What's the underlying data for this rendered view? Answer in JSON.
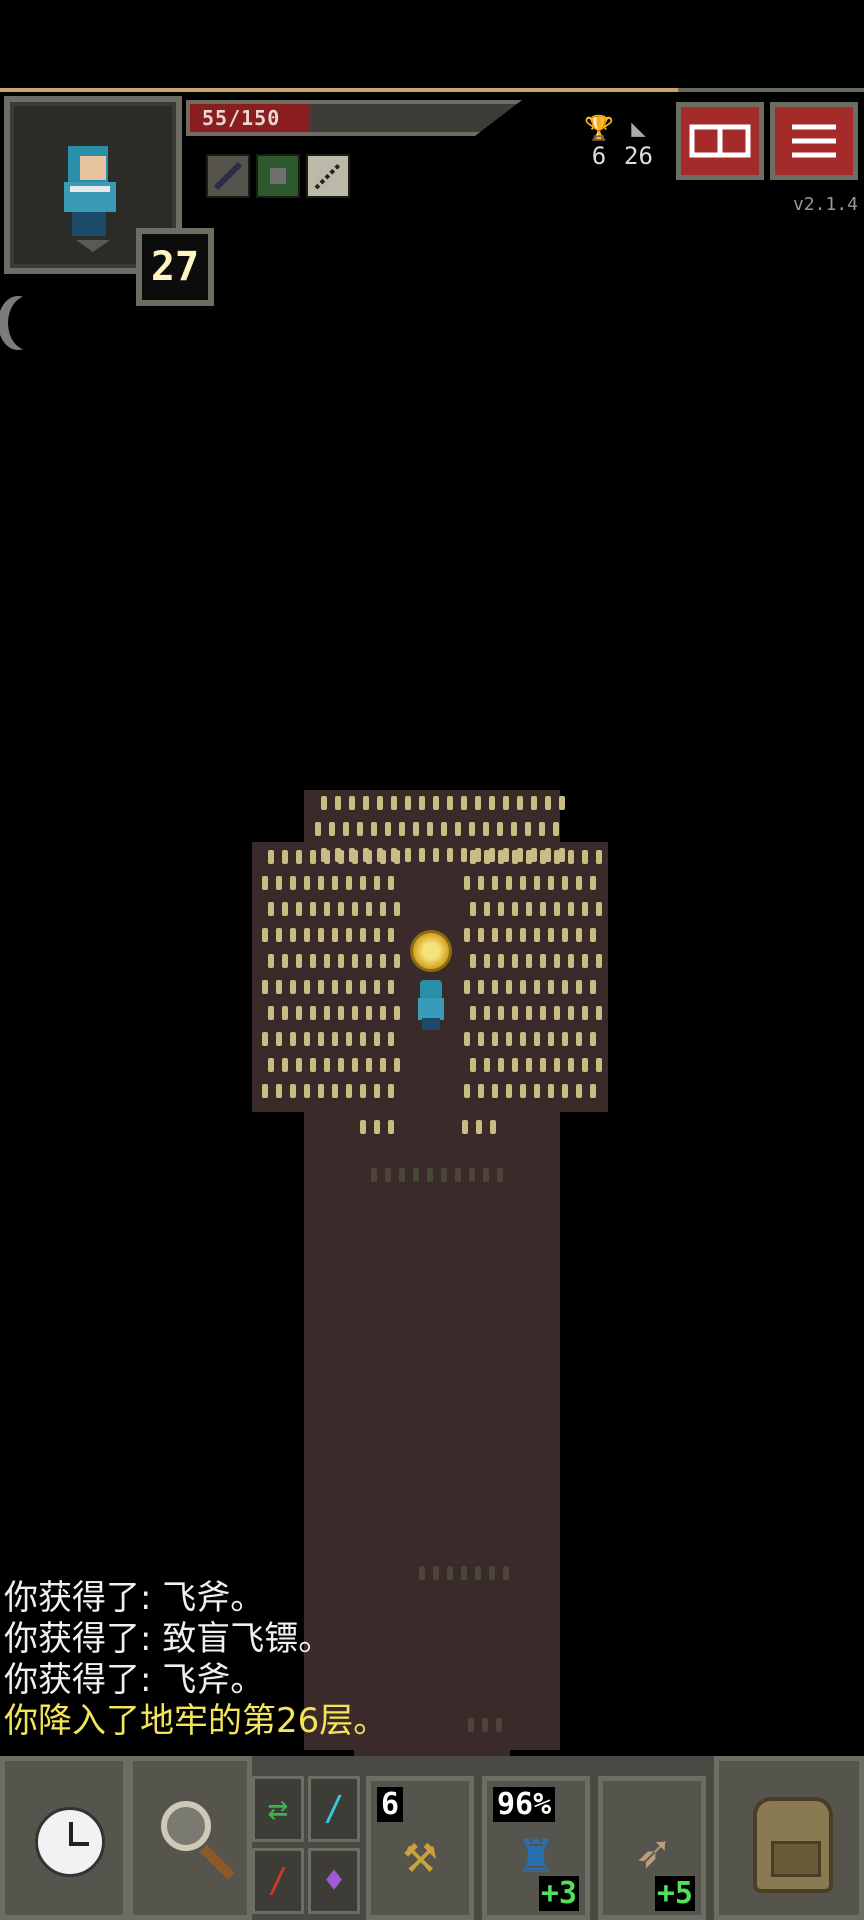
{
  "status": {
    "hp_text": "55/150",
    "hp_fraction": 0.367,
    "level": "27",
    "gold_count": "6",
    "depth": "26",
    "version": "v2.1.4"
  },
  "buttons": {
    "journal_icon": "journal-icon",
    "menu_icon": "menu-icon"
  },
  "log": [
    "你获得了: 飞斧。",
    "你获得了: 致盲飞镖。",
    "你获得了: 飞斧。",
    "你降入了地牢的第26层。"
  ],
  "toolbar": {
    "quickslot1_count": "6",
    "quickslot2_count": "96%",
    "quickslot2_bonus": "+3",
    "quickslot3_bonus": "+5"
  },
  "colors": {
    "hp": "#8a1e1e",
    "highlight_text": "#f3e55a",
    "floor": "#3b2a2a",
    "grass": "#c9bd86"
  }
}
